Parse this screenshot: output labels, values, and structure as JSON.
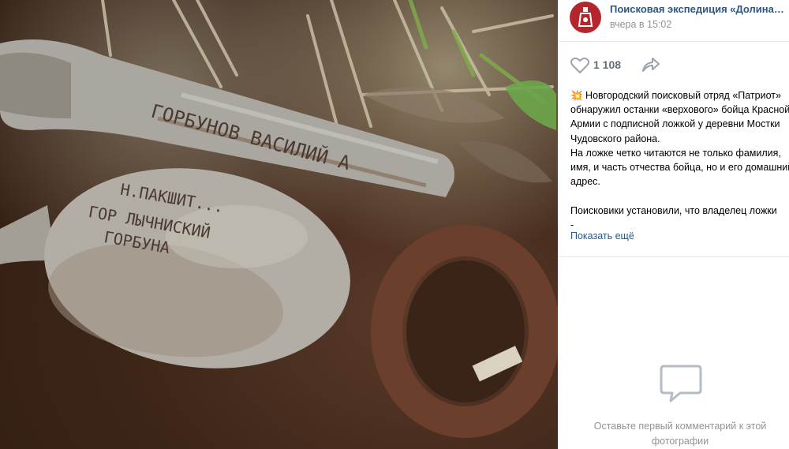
{
  "photo": {
    "description_icon": "photo",
    "spoon1_engraving": "ГОРБУНОВ ВАСИЛИЙ А",
    "spoon2_engraving_lines": [
      "Н.ПАКШИТ...",
      "ГОР ЛЫЧНИСКИЙ",
      "ГОРБУНА"
    ]
  },
  "post": {
    "author": "Поисковая экспедиция «Долина» ...",
    "time": "вчера в 15:02",
    "likes": "1 108",
    "text": "💥 Новгородский поисковый отряд «Патриот» обнаружил останки «верхового» бойца Красной Армии с подписной ложкой у деревни Мостки Чудовского района.\nНа ложке четко читаются не только фамилия, имя, и часть отчества бойца, но и его домашний адрес.\n\nПоисковики установили, что владелец ложки\n-",
    "show_more": "Показать ещё"
  },
  "comments": {
    "empty_text": "Оставьте первый комментарий к этой фотографии"
  },
  "colors": {
    "link": "#2a5885",
    "muted": "#939393",
    "avatar_bg": "#b3262b"
  }
}
